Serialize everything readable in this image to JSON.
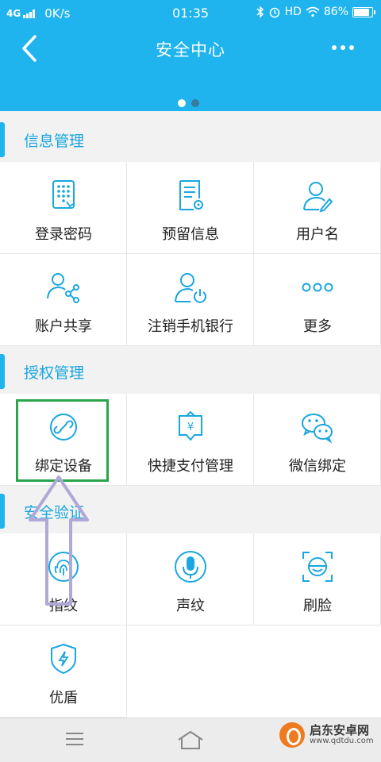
{
  "status_bar": {
    "network": "4G",
    "speed": "0K/s",
    "time": "01:35",
    "hd": "HD",
    "battery": "86%"
  },
  "header": {
    "title": "安全中心"
  },
  "sections": [
    {
      "label": "信息管理"
    },
    {
      "label": "授权管理"
    },
    {
      "label": "安全验证"
    }
  ],
  "items": {
    "login_password": "登录密码",
    "reserved_info": "预留信息",
    "username": "用户名",
    "account_share": "账户共享",
    "cancel_mobile_bank": "注销手机银行",
    "more": "更多",
    "bind_device": "绑定设备",
    "quick_pay": "快捷支付管理",
    "wechat_bind": "微信绑定",
    "fingerprint": "指纹",
    "voiceprint": "声纹",
    "face": "刷脸",
    "shield": "优盾"
  },
  "watermark": {
    "name": "启东安卓网",
    "url": "www.qdtdu.com"
  },
  "colors": {
    "accent": "#1fb4ee",
    "highlight": "#2aa54b",
    "arrow": "#b0a8d6"
  }
}
